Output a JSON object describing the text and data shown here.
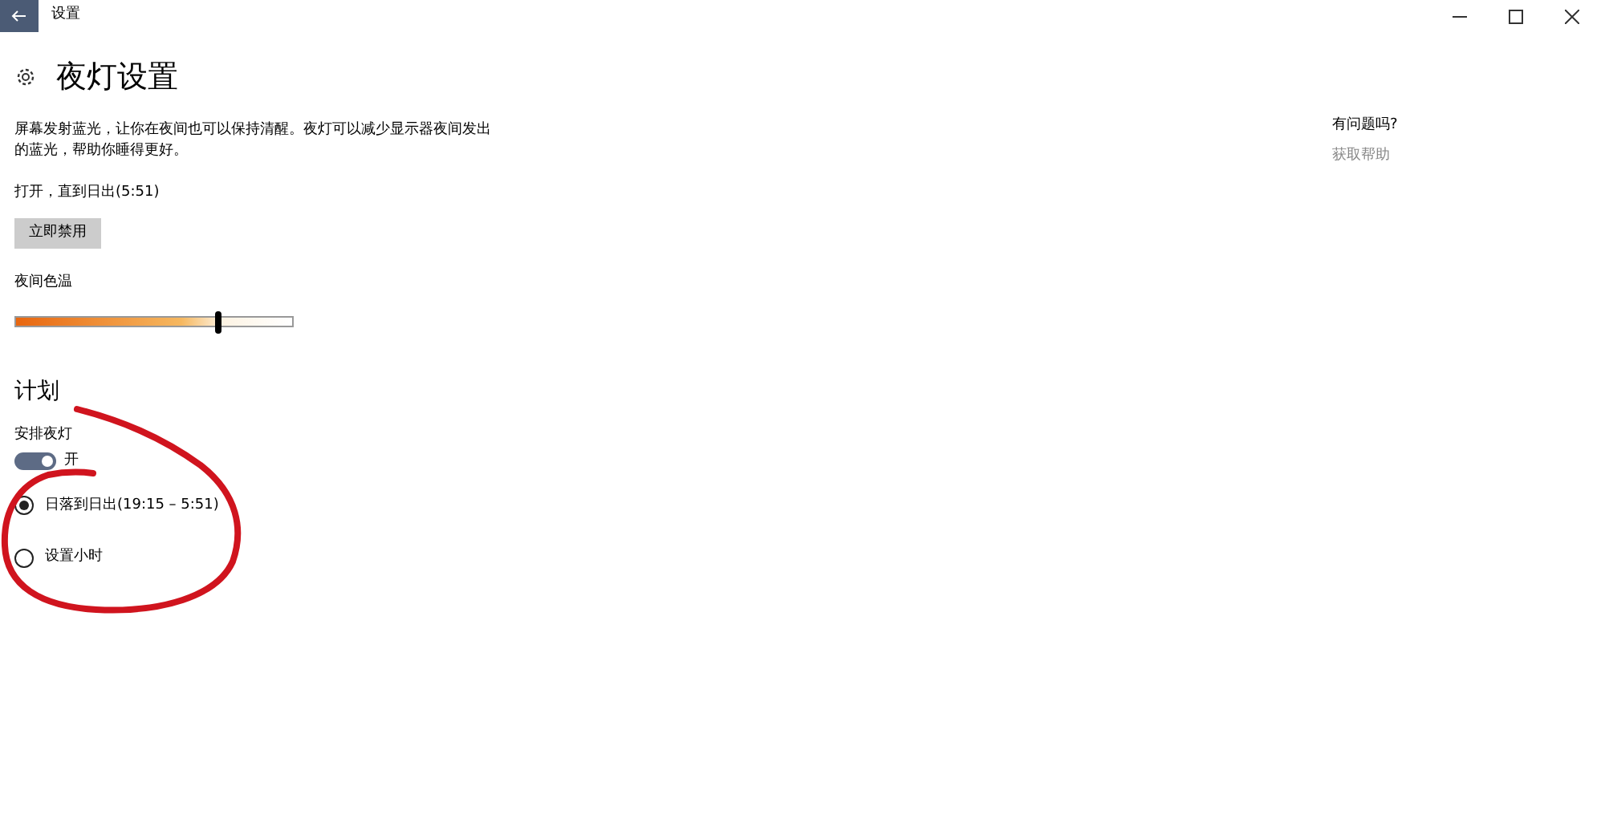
{
  "window": {
    "title": "设置"
  },
  "page": {
    "title": "夜灯设置"
  },
  "description": "屏幕发射蓝光，让你在夜间也可以保持清醒。夜灯可以减少显示器夜间发出的蓝光，帮助你睡得更好。",
  "status": "打开，直到日出(5:51)",
  "disable_button": "立即禁用",
  "color_temperature": {
    "label": "夜间色温",
    "level": 0.73
  },
  "schedule": {
    "heading": "计划",
    "toggle_label": "安排夜灯",
    "toggle": {
      "on": true,
      "text": "开"
    },
    "options": [
      {
        "label": "日落到日出(19:15 – 5:51)",
        "selected": true
      },
      {
        "label": "设置小时",
        "selected": false
      }
    ]
  },
  "help": {
    "question": "有问题吗?",
    "link": "获取帮助"
  }
}
